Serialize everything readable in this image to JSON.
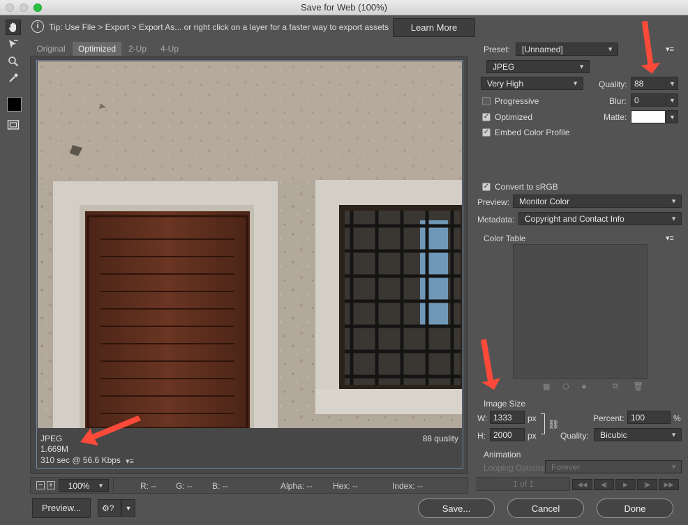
{
  "window": {
    "title": "Save for Web (100%)"
  },
  "tip": {
    "text": "Tip: Use File > Export > Export As...  or right click on a layer for a faster way to export assets",
    "learn_more": "Learn More"
  },
  "tabs": [
    "Original",
    "Optimized",
    "2-Up",
    "4-Up"
  ],
  "preview_info": {
    "format": "JPEG",
    "size": "1.669M",
    "time": "310 sec @ 56.6 Kbps",
    "quality_label": "88 quality"
  },
  "statusbar": {
    "zoom": "100%",
    "r": "R: --",
    "g": "G: --",
    "b": "B: --",
    "alpha": "Alpha: --",
    "hex": "Hex: --",
    "index": "Index: --"
  },
  "settings": {
    "preset_label": "Preset:",
    "preset_value": "[Unnamed]",
    "format_value": "JPEG",
    "compression_value": "Very High",
    "quality_label": "Quality:",
    "quality_value": "88",
    "blur_label": "Blur:",
    "blur_value": "0",
    "matte_label": "Matte:",
    "progressive_label": "Progressive",
    "progressive_checked": false,
    "optimized_label": "Optimized",
    "optimized_checked": true,
    "embed_label": "Embed Color Profile",
    "embed_checked": true,
    "convert_label": "Convert to sRGB",
    "convert_checked": true,
    "preview_label": "Preview:",
    "preview_value": "Monitor Color",
    "metadata_label": "Metadata:",
    "metadata_value": "Copyright and Contact Info",
    "color_table_label": "Color Table"
  },
  "image_size": {
    "title": "Image Size",
    "w_label": "W:",
    "w_value": "1333",
    "h_label": "H:",
    "h_value": "2000",
    "unit": "px",
    "percent_label": "Percent:",
    "percent_value": "100",
    "percent_unit": "%",
    "quality_label": "Quality:",
    "quality_value": "Bicubic"
  },
  "animation": {
    "title": "Animation",
    "looping_label": "Looping Options:",
    "looping_value": "Forever",
    "frame_counter": "1 of 1"
  },
  "footer": {
    "preview_button": "Preview...",
    "save_button": "Save...",
    "cancel_button": "Cancel",
    "done_button": "Done"
  },
  "colors": {
    "accent_arrow": "#ff4a3a",
    "selection_frame": "#6f87a8",
    "background": "#535353"
  }
}
